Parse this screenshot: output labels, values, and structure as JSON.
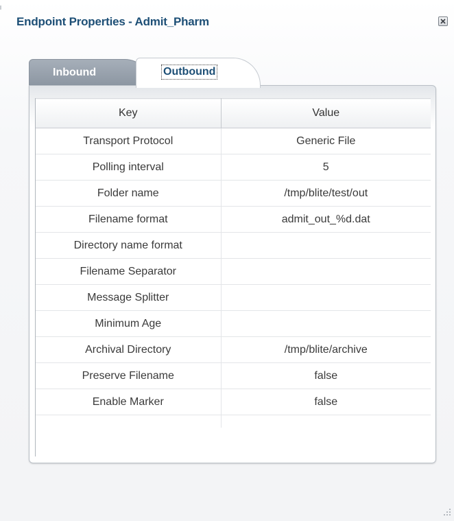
{
  "dialog": {
    "title": "Endpoint Properties - Admit_Pharm"
  },
  "tabs": [
    {
      "label": "Inbound",
      "selected": false
    },
    {
      "label": "Outbound",
      "selected": true
    }
  ],
  "table": {
    "columns": [
      "Key",
      "Value"
    ],
    "rows": [
      {
        "key": "Transport Protocol",
        "value": "Generic File"
      },
      {
        "key": "Polling interval",
        "value": "5"
      },
      {
        "key": "Folder name",
        "value": "/tmp/blite/test/out"
      },
      {
        "key": "Filename format",
        "value": "admit_out_%d.dat"
      },
      {
        "key": "Directory name format",
        "value": ""
      },
      {
        "key": "Filename Separator",
        "value": ""
      },
      {
        "key": "Message Splitter",
        "value": ""
      },
      {
        "key": "Minimum Age",
        "value": ""
      },
      {
        "key": "Archival Directory",
        "value": "/tmp/blite/archive"
      },
      {
        "key": "Preserve Filename",
        "value": "false"
      },
      {
        "key": "Enable Marker",
        "value": "false"
      },
      {
        "key": "",
        "value": ""
      }
    ]
  },
  "icons": {
    "close": "close-icon",
    "resize": "resize-grip-icon"
  },
  "colors": {
    "title": "#1d4f76",
    "tab_inactive": "#8b95a1",
    "tab_active_text": "#1d4f76"
  }
}
